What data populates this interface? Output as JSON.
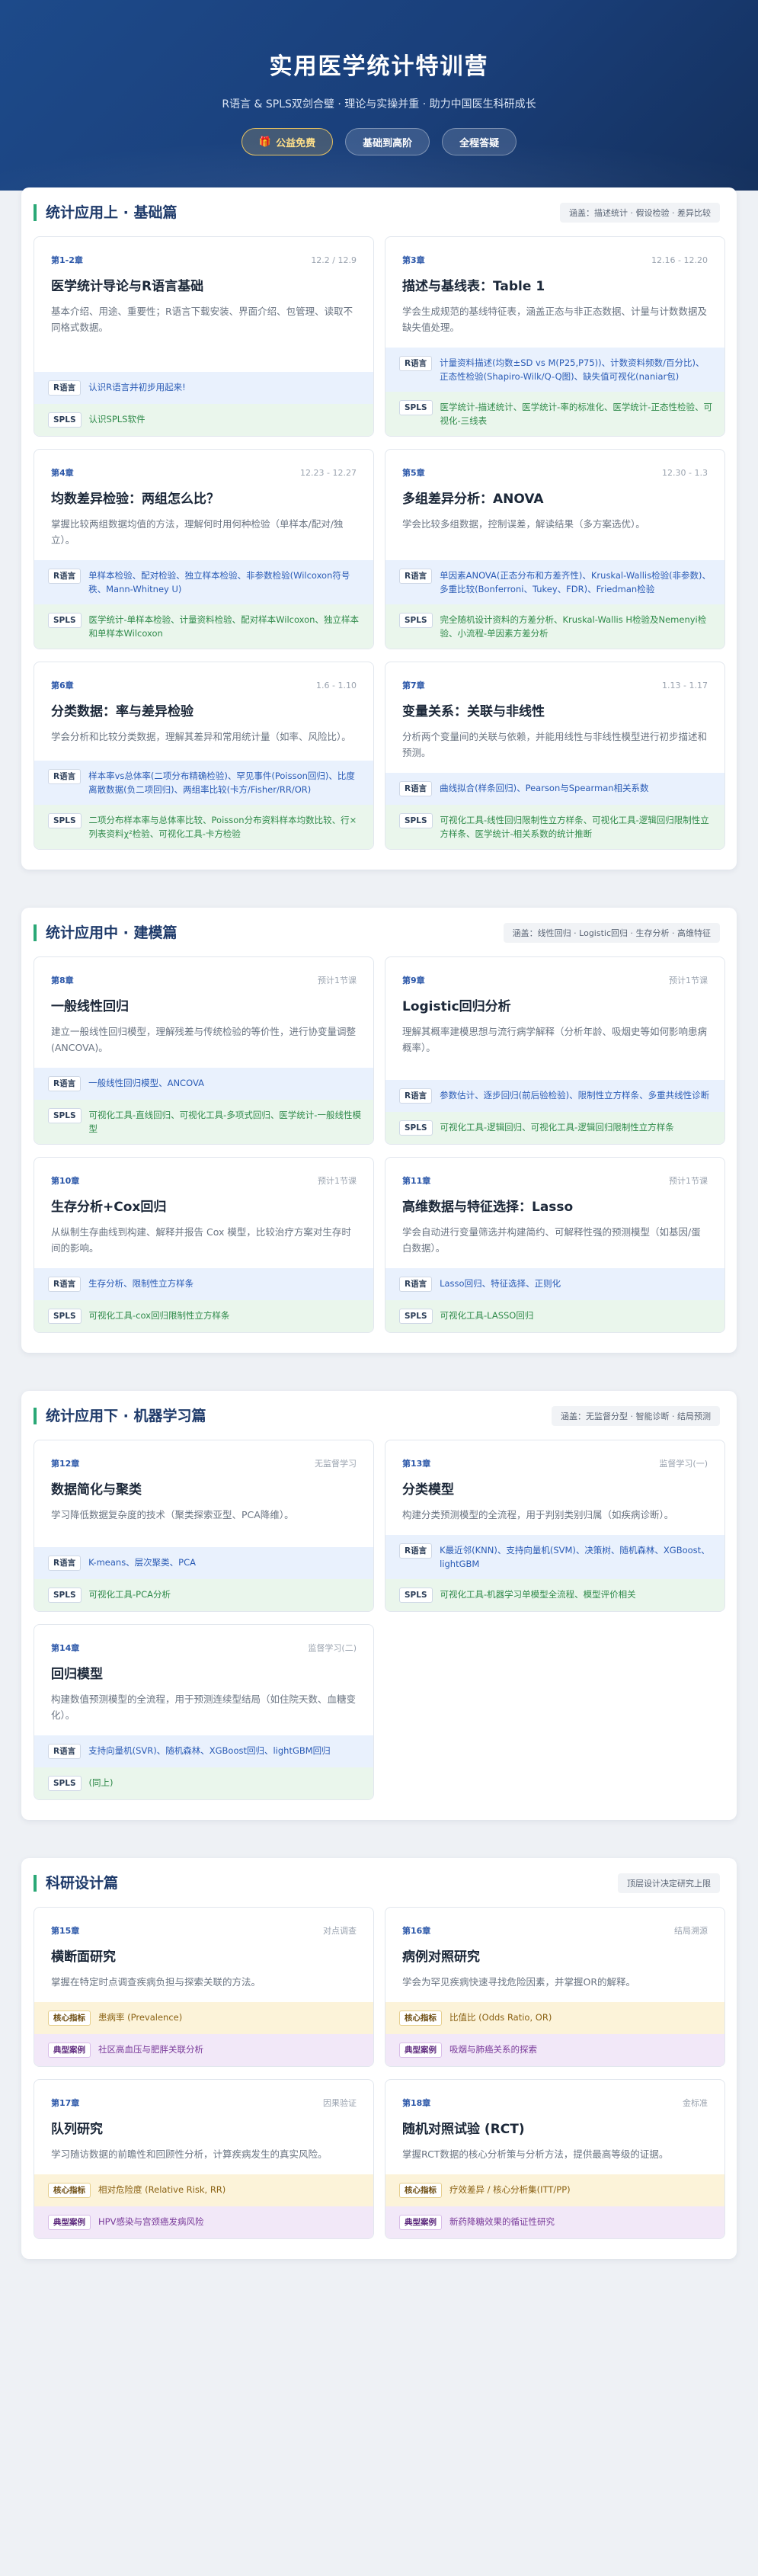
{
  "hero": {
    "title": "实用医学统计特训营",
    "subtitle": "R语言 & SPLS双剑合璧 · 理论与实操并重 · 助力中国医生科研成长",
    "pills": [
      "公益免费",
      "基础到高阶",
      "全程答疑"
    ]
  },
  "sections": [
    {
      "title": "统计应用上 · 基础篇",
      "tag": "涵盖：描述统计 · 假设检验 · 差异比较",
      "cards": [
        {
          "chapter": "第1-2章",
          "date": "12.2 / 12.9",
          "title": "医学统计导论与R语言基础",
          "desc": "基本介绍、用途、重要性；R语言下载安装、界面介绍、包管理、读取不同格式数据。",
          "r": "认识R语言并初步用起来!",
          "s": "认识SPLS软件"
        },
        {
          "chapter": "第3章",
          "date": "12.16 - 12.20",
          "title": "描述与基线表：Table 1",
          "desc": "学会生成规范的基线特征表，涵盖正态与非正态数据、计量与计数数据及缺失值处理。",
          "r": "计量资料描述(均数±SD vs M(P25,P75))、计数资料频数/百分比)、正态性检验(Shapiro-Wilk/Q-Q图)、缺失值可视化(naniar包)",
          "s": "医学统计-描述统计、医学统计-率的标准化、医学统计-正态性检验、可视化-三线表"
        },
        {
          "chapter": "第4章",
          "date": "12.23 - 12.27",
          "title": "均数差异检验：两组怎么比？",
          "desc": "掌握比较两组数据均值的方法，理解何时用何种检验（单样本/配对/独立）。",
          "r": "单样本检验、配对检验、独立样本检验、非参数检验(Wilcoxon符号秩、Mann-Whitney U)",
          "s": "医学统计-单样本检验、计量资料检验、配对样本Wilcoxon、独立样本和单样本Wilcoxon"
        },
        {
          "chapter": "第5章",
          "date": "12.30 - 1.3",
          "title": "多组差异分析：ANOVA",
          "desc": "学会比较多组数据，控制误差，解读结果（多方案选优）。",
          "r": "单因素ANOVA(正态分布和方差齐性)、Kruskal-Wallis检验(非参数)、多重比较(Bonferroni、Tukey、FDR)、Friedman检验",
          "s": "完全随机设计资料的方差分析、Kruskal-Wallis H检验及Nemenyi检验、小流程-单因素方差分析"
        },
        {
          "chapter": "第6章",
          "date": "1.6 - 1.10",
          "title": "分类数据：率与差异检验",
          "desc": "学会分析和比较分类数据，理解其差异和常用统计量（如率、风险比）。",
          "r": "样本率vs总体率(二项分布精确检验)、罕见事件(Poisson回归)、比度离散数据(负二项回归)、两组率比较(卡方/Fisher/RR/OR)",
          "s": "二项分布样本率与总体率比较、Poisson分布资料样本均数比较、行×列表资料χ²检验、可视化工具-卡方检验"
        },
        {
          "chapter": "第7章",
          "date": "1.13 - 1.17",
          "title": "变量关系：关联与非线性",
          "desc": "分析两个变量间的关联与依赖，并能用线性与非线性模型进行初步描述和预测。",
          "r": "曲线拟合(样条回归)、Pearson与Spearman相关系数",
          "s": "可视化工具-线性回归限制性立方样条、可视化工具-逻辑回归限制性立方样条、医学统计-相关系数的统计推断"
        }
      ]
    },
    {
      "title": "统计应用中 · 建模篇",
      "tag": "涵盖：线性回归 · Logistic回归 · 生存分析 · 高维特征",
      "cards": [
        {
          "chapter": "第8章",
          "date": "预计1节课",
          "title": "一般线性回归",
          "desc": "建立一般线性回归模型，理解残差与传统检验的等价性，进行协变量调整(ANCOVA)。",
          "r": "一般线性回归模型、ANCOVA",
          "s": "可视化工具-直线回归、可视化工具-多项式回归、医学统计-一般线性模型"
        },
        {
          "chapter": "第9章",
          "date": "预计1节课",
          "title": "Logistic回归分析",
          "desc": "理解其概率建模思想与流行病学解释（分析年龄、吸烟史等如何影响患病概率）。",
          "r": "参数估计、逐步回归(前后验检验)、限制性立方样条、多重共线性诊断",
          "s": "可视化工具-逻辑回归、可视化工具-逻辑回归限制性立方样条"
        },
        {
          "chapter": "第10章",
          "date": "预计1节课",
          "title": "生存分析+Cox回归",
          "desc": "从纵制生存曲线到构建、解释并报告 Cox 模型，比较治疗方案对生存时间的影响。",
          "r": "生存分析、限制性立方样条",
          "s": "可视化工具-cox回归限制性立方样条"
        },
        {
          "chapter": "第11章",
          "date": "预计1节课",
          "title": "高维数据与特征选择：Lasso",
          "desc": "学会自动进行变量筛选并构建简约、可解释性强的预测模型（如基因/蛋白数据）。",
          "r": "Lasso回归、特征选择、正则化",
          "s": "可视化工具-LASSO回归"
        }
      ]
    },
    {
      "title": "统计应用下 · 机器学习篇",
      "tag": "涵盖：无监督分型 · 智能诊断 · 结局预测",
      "cards": [
        {
          "chapter": "第12章",
          "date": "无监督学习",
          "title": "数据简化与聚类",
          "desc": "学习降低数据复杂度的技术（聚类探索亚型、PCA降维）。",
          "r": "K-means、层次聚类、PCA",
          "s": "可视化工具-PCA分析"
        },
        {
          "chapter": "第13章",
          "date": "监督学习(一)",
          "title": "分类模型",
          "desc": "构建分类预测模型的全流程，用于判别类别归属（如疾病诊断）。",
          "r": "K最近邻(KNN)、支持向量机(SVM)、决策树、随机森林、XGBoost、lightGBM",
          "s": "可视化工具-机器学习单模型全流程、模型评价相关"
        },
        {
          "chapter": "第14章",
          "date": "监督学习(二)",
          "title": "回归模型",
          "desc": "构建数值预测模型的全流程，用于预测连续型结局（如住院天数、血糖变化）。",
          "r": "支持向量机(SVR)、随机森林、XGBoost回归、lightGBM回归",
          "s": "(同上)"
        }
      ]
    },
    {
      "title": "科研设计篇",
      "tag": "顶层设计决定研究上限",
      "cards": [
        {
          "chapter": "第15章",
          "date": "对点调查",
          "title": "横断面研究",
          "desc": "掌握在特定时点调查疾病负担与探索关联的方法。",
          "k": "患病率 (Prevalence)",
          "c": "社区高血压与肥胖关联分析"
        },
        {
          "chapter": "第16章",
          "date": "结局溯源",
          "title": "病例对照研究",
          "desc": "学会为罕见疾病快速寻找危险因素，并掌握OR的解释。",
          "k": "比值比 (Odds Ratio, OR)",
          "c": "吸烟与肺癌关系的探索"
        },
        {
          "chapter": "第17章",
          "date": "因果验证",
          "title": "队列研究",
          "desc": "学习随访数据的前瞻性和回顾性分析，计算疾病发生的真实风险。",
          "k": "相对危险度 (Relative Risk, RR)",
          "c": "HPV感染与宫颈癌发病风险"
        },
        {
          "chapter": "第18章",
          "date": "金标准",
          "title": "随机对照试验 (RCT)",
          "desc": "掌握RCT数据的核心分析策与分析方法，提供最高等级的证据。",
          "k": "疗效差异 / 核心分析集(ITT/PP)",
          "c": "新药降糖效果的循证性研究"
        }
      ]
    }
  ],
  "labels": {
    "r": "R语言",
    "s": "SPLS",
    "k": "核心指标",
    "c": "典型案例"
  }
}
